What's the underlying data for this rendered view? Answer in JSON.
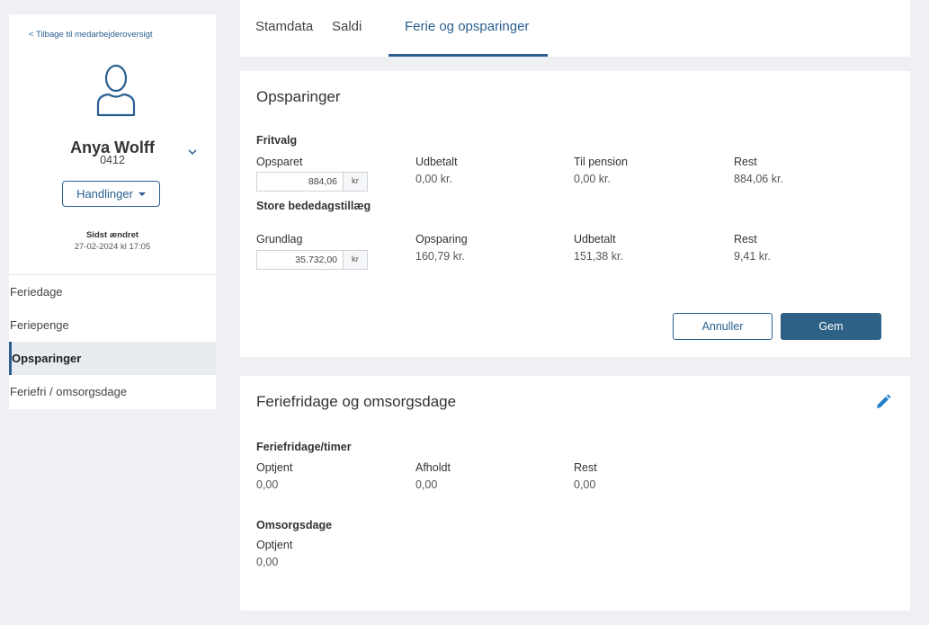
{
  "sidebar": {
    "back_link": "< Tilbage til medarbejderoversigt",
    "employee_name": "Anya Wolff",
    "employee_number": "0412",
    "actions_label": "Handlinger",
    "last_changed_label": "Sidst ændret",
    "last_changed_value": "27-02-2024 kl 17:05",
    "nav": [
      {
        "label": "Feriedage"
      },
      {
        "label": "Feriepenge"
      },
      {
        "label": "Opsparinger",
        "active": true
      },
      {
        "label": "Feriefri / omsorgsdage"
      }
    ]
  },
  "tabs": [
    {
      "label": "Stamdata"
    },
    {
      "label": "Saldi"
    },
    {
      "label": "Ferie og opsparinger",
      "active": true
    }
  ],
  "savings": {
    "title": "Opsparinger",
    "fritvalg": {
      "label": "Fritvalg",
      "saved_label": "Opsparet",
      "saved_value": "884,06",
      "saved_unit": "kr",
      "paid_label": "Udbetalt",
      "paid_value": "0,00 kr.",
      "pension_label": "Til pension",
      "pension_value": "0,00 kr.",
      "rest_label": "Rest",
      "rest_value": "884,06 kr."
    },
    "store_bededag": {
      "label": "Store bededagstillæg",
      "basis_label": "Grundlag",
      "basis_value": "35.732,00",
      "basis_unit": "kr",
      "saving_label": "Opsparing",
      "saving_value": "160,79 kr.",
      "paid_label": "Udbetalt",
      "paid_value": "151,38 kr.",
      "rest_label": "Rest",
      "rest_value": "9,41 kr."
    },
    "cancel_label": "Annuller",
    "save_label": "Gem"
  },
  "holidays": {
    "title": "Feriefridage og omsorgsdage",
    "feriefri": {
      "label": "Feriefridage/timer",
      "earned_label": "Optjent",
      "earned_value": "0,00",
      "taken_label": "Afholdt",
      "taken_value": "0,00",
      "rest_label": "Rest",
      "rest_value": "0,00"
    },
    "omsorg": {
      "label": "Omsorgsdage",
      "earned_label": "Optjent",
      "earned_value": "0,00"
    }
  },
  "colors": {
    "accent": "#2a5f8f",
    "save_button": "#2d6186",
    "edit_icon": "#1f7fc8",
    "background": "#eef0f3"
  },
  "icons": [
    "chevron-left-icon",
    "user-avatar-icon",
    "chevron-down-icon",
    "caret-down-icon",
    "pencil-icon"
  ]
}
